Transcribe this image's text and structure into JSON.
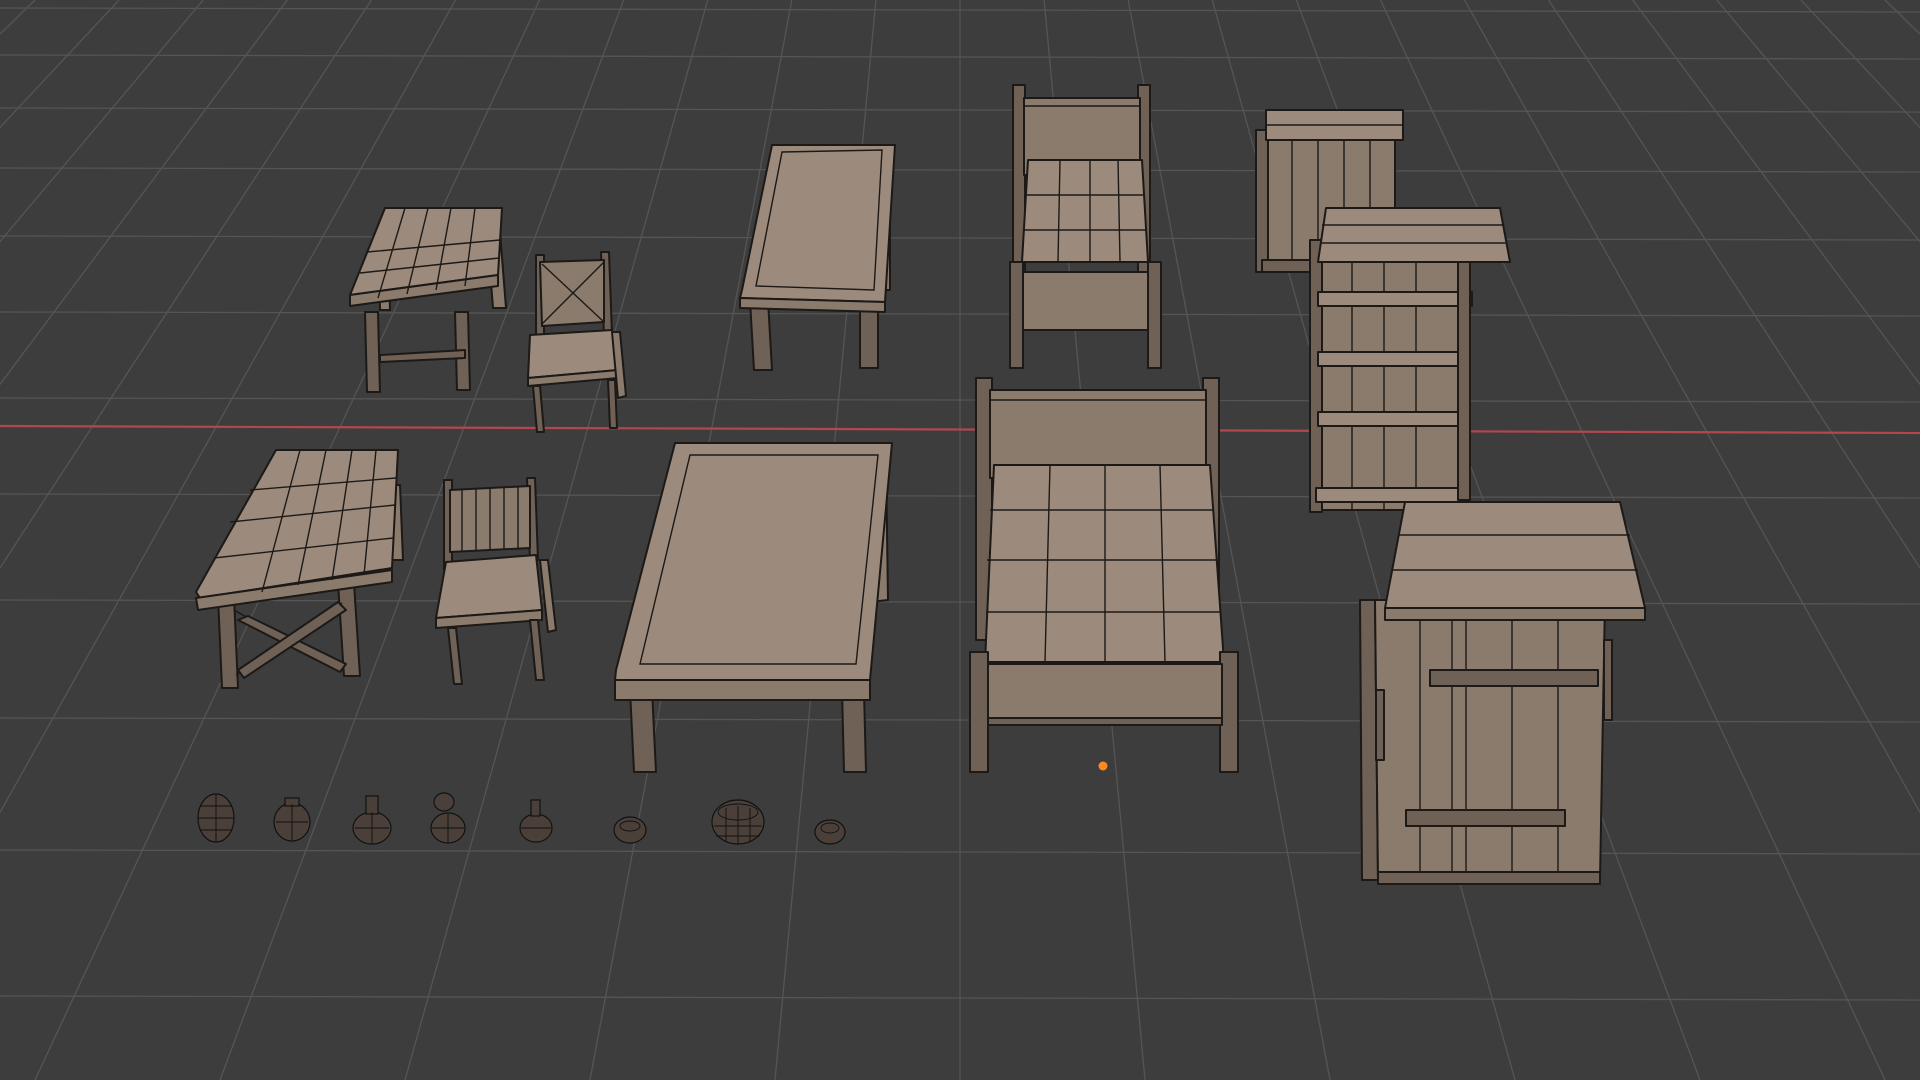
{
  "viewport": {
    "background": "#3d3d3d",
    "grid_color": "#555555",
    "x_axis_color": "#b3474f",
    "origin_color": "#ff8a1e",
    "wood_color": "#8b7b6d",
    "outline_color": "#1c1916"
  },
  "scene": {
    "objects": [
      "table-small-back",
      "chair-cross-back",
      "table-small-front",
      "chair-slat-back",
      "table-large-back",
      "table-large-front",
      "bed-single",
      "bed-double",
      "cabinet-small",
      "bookshelf",
      "wardrobe",
      "pottery-set"
    ]
  }
}
